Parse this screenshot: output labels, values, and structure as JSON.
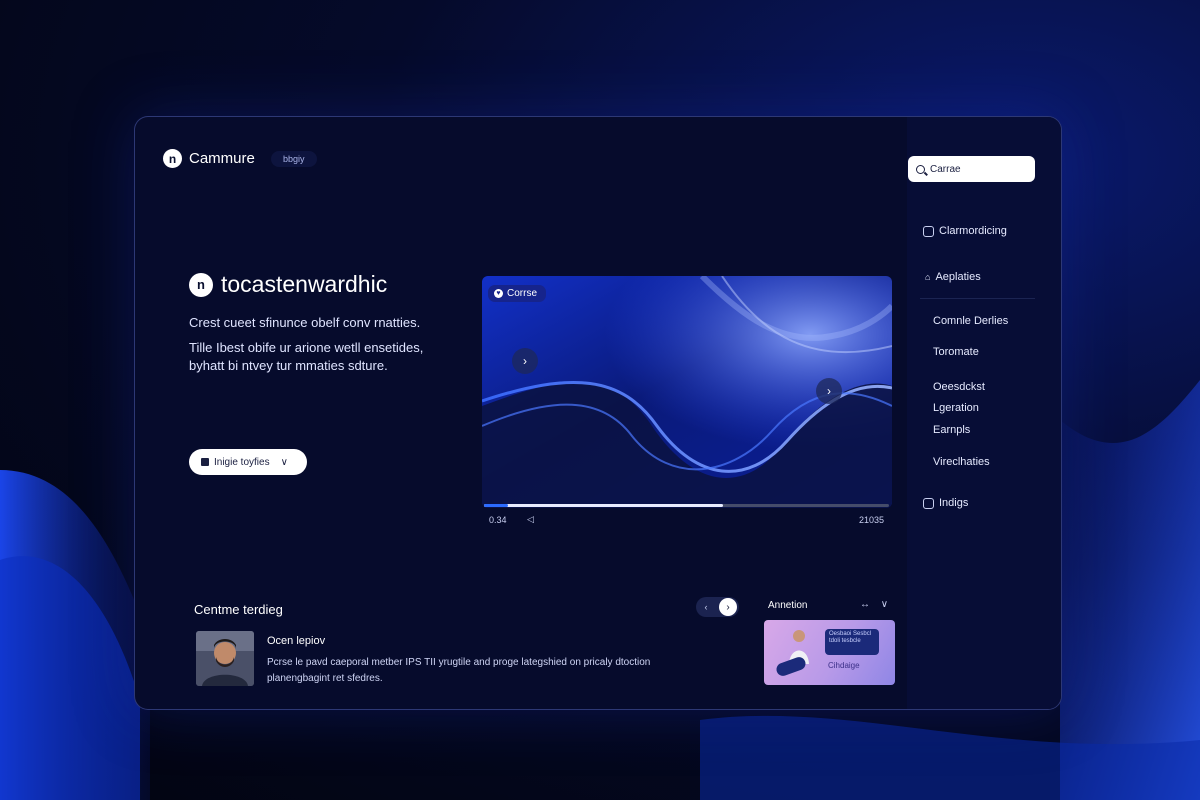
{
  "brand": {
    "logo_glyph": "n",
    "name": "Cammure",
    "tag": "bbgiy"
  },
  "hero": {
    "logo_glyph": "n",
    "title": "tocastenwardhic",
    "description_line1": "Crest cueet sfinunce obelf conv rnatties.",
    "description_line2": "Tille Ibest obife ur arione wetll ensetides, byhatt bi ntvey tur mmaties sdture.",
    "dropdown_label": "Inigie toyfies",
    "dropdown_chevron": "∨"
  },
  "video": {
    "badge_label": "Corrse",
    "play_prev_glyph": "›",
    "play_next_glyph": "›",
    "progress_fraction": 0.59,
    "time_current": "0.34",
    "volume_glyph": "◁",
    "time_total": "21035"
  },
  "bottom": {
    "section_title": "Centme terdieg",
    "carousel_prev": "‹",
    "carousel_next": "›",
    "card_title": "Ocen lepiov",
    "card_desc": "Pcrse le pavd caeporal metber IPS TII yrugtile and proge lategshied on pricaly dtoction planengbagint ret sfedres.",
    "annotation_title": "Annetion",
    "annotation_icons": "↔ ∨",
    "annotation_pill": "Oesbaoi Sesbcl tdoli tesbcle",
    "annotation_label": "Cihdaige"
  },
  "sidebar": {
    "search_value": "Carrae",
    "items": [
      {
        "label": "Clarmordicing"
      },
      {
        "label": "Aeplaties"
      },
      {
        "label": "Comnle Derlies"
      },
      {
        "label": "Toromate"
      },
      {
        "label": "Oeesdckst"
      },
      {
        "label": "Lgeration"
      },
      {
        "label": "Earnpls"
      },
      {
        "label": "Vireclhaties"
      },
      {
        "label": "Indigs"
      }
    ]
  }
}
